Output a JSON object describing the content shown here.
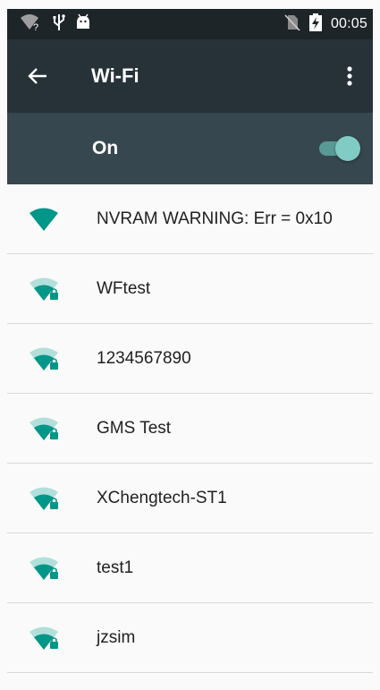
{
  "status_bar": {
    "time": "00:05",
    "icons": [
      "wifi-unknown-icon",
      "usb-icon",
      "android-debug-icon",
      "no-sim-icon",
      "battery-charging-icon"
    ]
  },
  "app_bar": {
    "title": "Wi-Fi",
    "back_icon": "arrow-back-icon",
    "menu_icon": "more-vert-icon"
  },
  "master_switch": {
    "label": "On",
    "state": true
  },
  "networks": [
    {
      "ssid": "NVRAM WARNING: Err = 0x10",
      "secured": false,
      "signal": "full"
    },
    {
      "ssid": "WFtest",
      "secured": true,
      "signal": "good"
    },
    {
      "ssid": "1234567890",
      "secured": true,
      "signal": "good"
    },
    {
      "ssid": "GMS Test",
      "secured": true,
      "signal": "good"
    },
    {
      "ssid": "XChengtech-ST1",
      "secured": true,
      "signal": "good"
    },
    {
      "ssid": "test1",
      "secured": true,
      "signal": "good"
    },
    {
      "ssid": "jzsim",
      "secured": true,
      "signal": "good"
    }
  ],
  "colors": {
    "status_bar": "#1e2529",
    "app_bar": "#263238",
    "switch_bar": "#37474f",
    "accent": "#009688",
    "toggle_thumb": "#80cbc4"
  }
}
